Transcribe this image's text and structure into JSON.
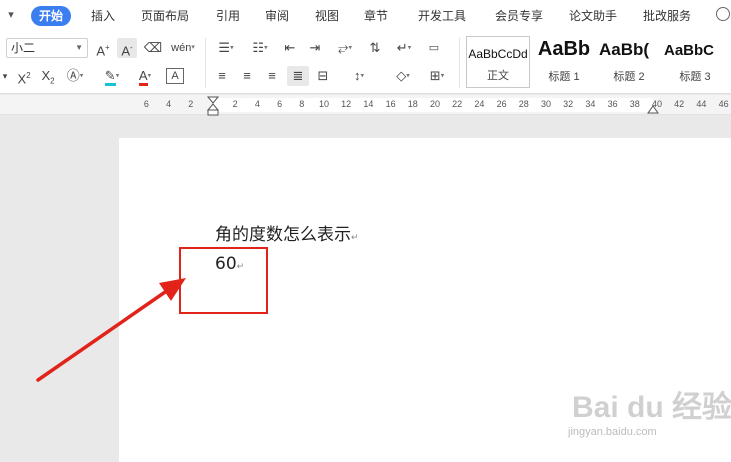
{
  "menu": {
    "tabs": [
      "开始",
      "插入",
      "页面布局",
      "引用",
      "审阅",
      "视图",
      "章节",
      "开发工具",
      "会员专享",
      "论文助手",
      "批改服务"
    ]
  },
  "toolbar": {
    "font_size": "小二",
    "styles": [
      {
        "sample": "AaBbCcDd",
        "name": "正文"
      },
      {
        "sample": "AaBb",
        "name": "标题 1"
      },
      {
        "sample": "AaBb(",
        "name": "标题 2"
      },
      {
        "sample": "AaBbC",
        "name": "标题 3"
      }
    ]
  },
  "ruler": {
    "left_numbers": [
      "6",
      "4",
      "2"
    ],
    "right_numbers": [
      "2",
      "4",
      "6",
      "8",
      "10",
      "12",
      "14",
      "16",
      "18",
      "20",
      "22",
      "24",
      "26",
      "28",
      "30",
      "32",
      "34",
      "36",
      "38",
      "40",
      "42",
      "44",
      "46"
    ]
  },
  "document": {
    "line1": "角的度数怎么表示",
    "line2": "60",
    "paragraph_mark": "↵"
  },
  "watermark": {
    "main": "Bai du 经验",
    "sub": "jingyan.baidu.com"
  },
  "colors": {
    "accent": "#3b7ef0",
    "annotation": "#e2231a"
  }
}
